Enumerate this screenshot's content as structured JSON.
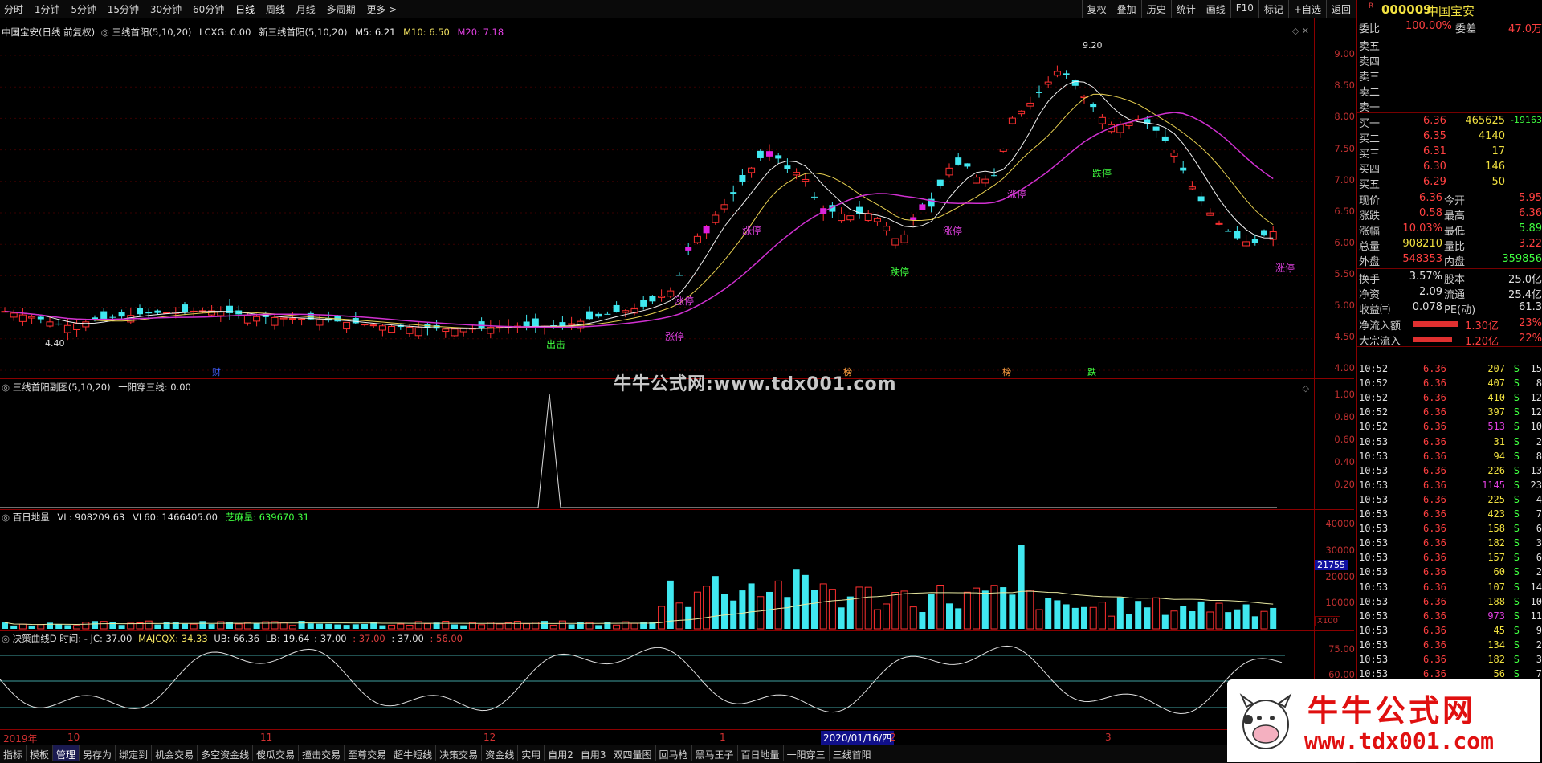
{
  "toolbar": {
    "periods": [
      "分时",
      "1分钟",
      "5分钟",
      "15分钟",
      "30分钟",
      "60分钟",
      "日线",
      "周线",
      "月线",
      "多周期",
      "更多 >"
    ],
    "active_period": "日线",
    "right_buttons": [
      "复权",
      "叠加",
      "历史",
      "统计",
      "画线",
      "F10",
      "标记",
      "+自选",
      "返回"
    ]
  },
  "main_chart": {
    "header": {
      "stock": "中国宝安(日线 前复权)",
      "indicator": "三线首阳(5,10,20)",
      "lcxg": "LCXG: 0.00",
      "new_indicator": "新三线首阳(5,10,20)",
      "m5": "M5: 6.21",
      "m10": "M10: 6.50",
      "m20": "M20: 7.18"
    },
    "y_labels": [
      "9.00",
      "8.50",
      "8.00",
      "7.50",
      "7.00",
      "6.50",
      "6.00",
      "5.50",
      "5.00",
      "4.50",
      "4.00"
    ],
    "annotations": {
      "high": "9.20",
      "low": "4.40",
      "chuji": "出击",
      "zt1": "涨停",
      "zt2": "涨停",
      "zt3": "涨停",
      "zt4": "涨停",
      "zt5": "涨停",
      "zt6": "涨停",
      "zt7": "涨停",
      "dt1": "跌停",
      "dt2": "跌停",
      "cai": "财",
      "bang1": "榜",
      "bang2": "榜",
      "die": "跌"
    },
    "watermark": "牛牛公式网:www.tdx001.com"
  },
  "sub1": {
    "header": {
      "name": "三线首阳副图(5,10,20)",
      "value": "一阳穿三线: 0.00"
    },
    "y_labels": [
      "1.00",
      "0.80",
      "0.60",
      "0.40",
      "0.20"
    ]
  },
  "sub2": {
    "header": {
      "name": "百日地量",
      "vl": "VL: 908209.63",
      "vl60": "VL60: 1466405.00",
      "zm": "芝麻量: 639670.31"
    },
    "y_labels": [
      "40000",
      "30000",
      "20000",
      "10000"
    ],
    "marker": "21755",
    "unit": "X100"
  },
  "sub3": {
    "header": {
      "name": "决策曲线D",
      "time": "时间: -",
      "jc": "JC: 37.00",
      "majcqx": "MAJCQX: 34.33",
      "ub": "UB: 66.36",
      "lb": "LB: 19.64",
      "v1": ": 37.00",
      "v2": ": 37.00",
      "v3": ": 37.00",
      "v4": ": 56.00"
    },
    "y_labels": [
      "75.00",
      "60.00"
    ]
  },
  "date_axis": {
    "labels": [
      "2019年",
      "10",
      "11",
      "12",
      "1",
      "2",
      "3"
    ],
    "highlight": "2020/01/16/四"
  },
  "bottom_tabs": [
    "指标",
    "模板",
    "管理",
    "另存为",
    "绑定到",
    "机会交易",
    "多空资金线",
    "傻瓜交易",
    "撞击交易",
    "至尊交易",
    "超牛短线",
    "决策交易",
    "资金线",
    "实用",
    "自用2",
    "自用3",
    "双四量图",
    "回马枪",
    "黑马王子",
    "百日地量",
    "一阳穿三",
    "三线首阳"
  ],
  "active_tab": "管理",
  "quote": {
    "code": "000009",
    "name": "中国宝安",
    "weibi_label": "委比",
    "weibi": "100.00%",
    "weicha_label": "委差",
    "weicha": "47.0万",
    "sell": [
      {
        "label": "卖五",
        "price": "",
        "vol": ""
      },
      {
        "label": "卖四",
        "price": "",
        "vol": ""
      },
      {
        "label": "卖三",
        "price": "",
        "vol": ""
      },
      {
        "label": "卖二",
        "price": "",
        "vol": ""
      },
      {
        "label": "卖一",
        "price": "",
        "vol": ""
      }
    ],
    "buy": [
      {
        "label": "买一",
        "price": "6.36",
        "vol": "465625",
        "chg": "-19163"
      },
      {
        "label": "买二",
        "price": "6.35",
        "vol": "4140",
        "chg": ""
      },
      {
        "label": "买三",
        "price": "6.31",
        "vol": "17",
        "chg": ""
      },
      {
        "label": "买四",
        "price": "6.30",
        "vol": "146",
        "chg": ""
      },
      {
        "label": "买五",
        "price": "6.29",
        "vol": "50",
        "chg": ""
      }
    ],
    "stats": [
      {
        "l1": "现价",
        "v1": "6.36",
        "l2": "今开",
        "v2": "5.95"
      },
      {
        "l1": "涨跌",
        "v1": "0.58",
        "l2": "最高",
        "v2": "6.36"
      },
      {
        "l1": "涨幅",
        "v1": "10.03%",
        "l2": "最低",
        "v2": "5.89"
      },
      {
        "l1": "总量",
        "v1": "908210",
        "l2": "量比",
        "v2": "3.22"
      },
      {
        "l1": "外盘",
        "v1": "548353",
        "l2": "内盘",
        "v2": "359856"
      }
    ],
    "stats2": [
      {
        "l1": "换手",
        "v1": "3.57%",
        "l2": "股本",
        "v2": "25.0亿"
      },
      {
        "l1": "净资",
        "v1": "2.09",
        "l2": "流通",
        "v2": "25.4亿"
      },
      {
        "l1": "收益㈢",
        "v1": "0.078",
        "l2": "PE(动)",
        "v2": "61.3"
      }
    ],
    "flows": [
      {
        "label": "净流入额",
        "val": "1.30亿",
        "pct": "23%"
      },
      {
        "label": "大宗流入",
        "val": "1.20亿",
        "pct": "22%"
      }
    ],
    "ticks": [
      [
        "10:52",
        "6.36",
        "207",
        "S",
        "15"
      ],
      [
        "10:52",
        "6.36",
        "407",
        "S",
        "8"
      ],
      [
        "10:52",
        "6.36",
        "410",
        "S",
        "12"
      ],
      [
        "10:52",
        "6.36",
        "397",
        "S",
        "12"
      ],
      [
        "10:52",
        "6.36",
        "513",
        "S",
        "10"
      ],
      [
        "10:53",
        "6.36",
        "31",
        "S",
        "2"
      ],
      [
        "10:53",
        "6.36",
        "94",
        "S",
        "8"
      ],
      [
        "10:53",
        "6.36",
        "226",
        "S",
        "13"
      ],
      [
        "10:53",
        "6.36",
        "1145",
        "S",
        "23"
      ],
      [
        "10:53",
        "6.36",
        "225",
        "S",
        "4"
      ],
      [
        "10:53",
        "6.36",
        "423",
        "S",
        "7"
      ],
      [
        "10:53",
        "6.36",
        "158",
        "S",
        "6"
      ],
      [
        "10:53",
        "6.36",
        "182",
        "S",
        "3"
      ],
      [
        "10:53",
        "6.36",
        "157",
        "S",
        "6"
      ],
      [
        "10:53",
        "6.36",
        "60",
        "S",
        "2"
      ],
      [
        "10:53",
        "6.36",
        "107",
        "S",
        "14"
      ],
      [
        "10:53",
        "6.36",
        "188",
        "S",
        "10"
      ],
      [
        "10:53",
        "6.36",
        "973",
        "S",
        "11"
      ],
      [
        "10:53",
        "6.36",
        "45",
        "S",
        "9"
      ],
      [
        "10:53",
        "6.36",
        "134",
        "S",
        "2"
      ],
      [
        "10:53",
        "6.36",
        "182",
        "S",
        "3"
      ],
      [
        "10:53",
        "6.36",
        "56",
        "S",
        "7"
      ]
    ]
  },
  "logo": {
    "text": "牛牛公式网",
    "url": "www.tdx001.com"
  }
}
